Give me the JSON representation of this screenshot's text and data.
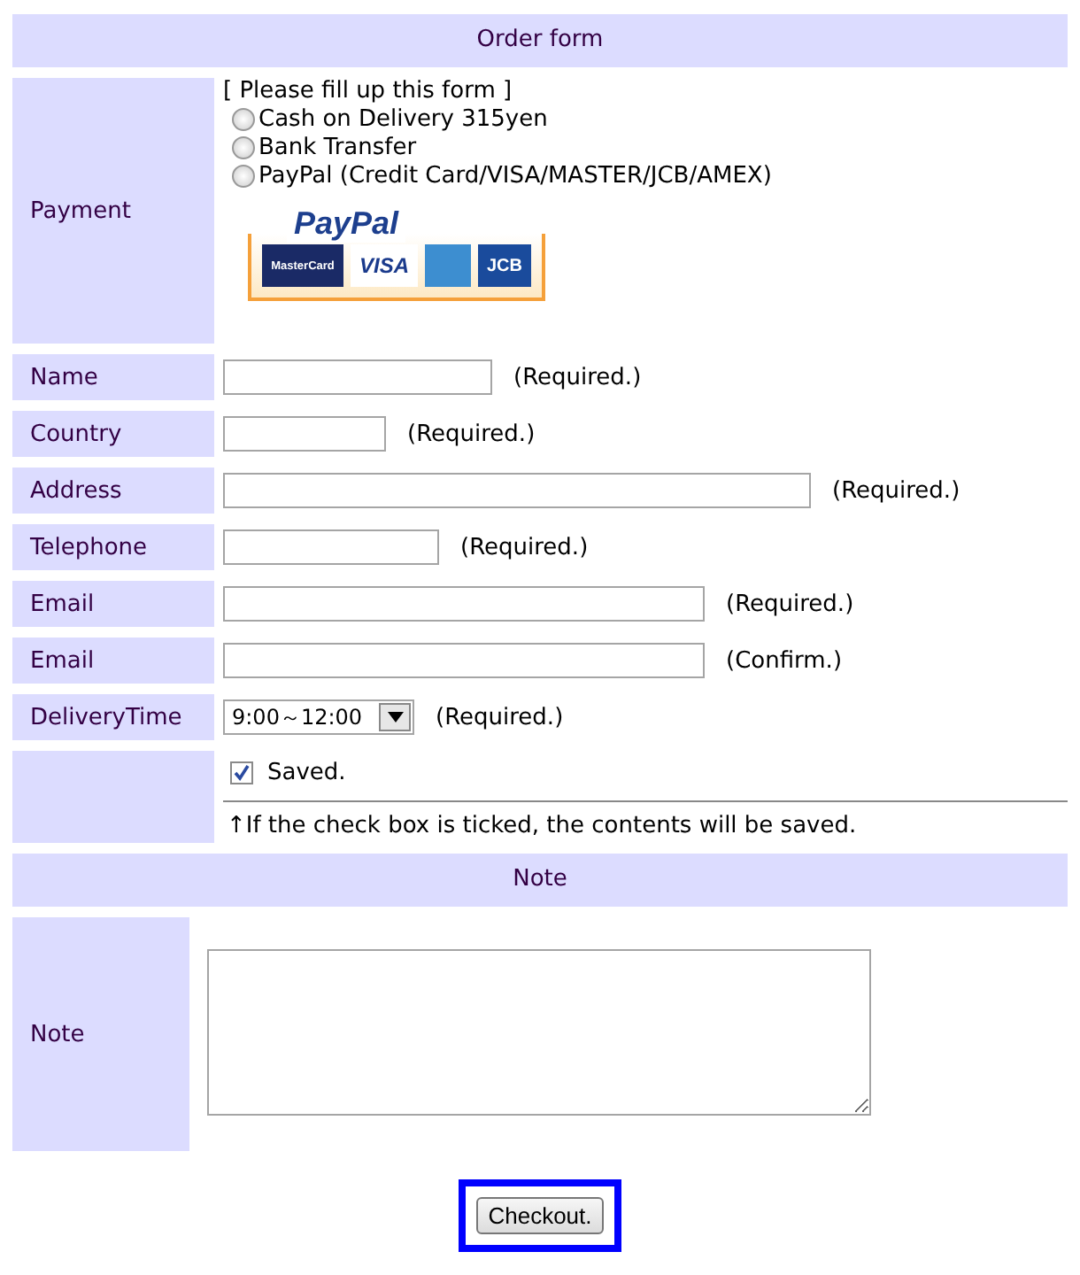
{
  "header": "Order form",
  "payment": {
    "label": "Payment",
    "intro": "[ Please fill up this form ]",
    "options": [
      {
        "label": "Cash on Delivery 315yen",
        "selected": false
      },
      {
        "label": "Bank Transfer",
        "selected": false
      },
      {
        "label": "PayPal (Credit Card/VISA/MASTER/JCB/AMEX)",
        "selected": false
      }
    ],
    "logo": {
      "title": "PayPal",
      "cards": [
        "MasterCard",
        "VISA",
        "JCB"
      ]
    }
  },
  "fields": [
    {
      "kind": "text",
      "label": "Name",
      "hint": "(Required.)"
    },
    {
      "kind": "text",
      "label": "Country",
      "hint": "(Required.)"
    },
    {
      "kind": "text",
      "label": "Address",
      "hint": "(Required.)"
    },
    {
      "kind": "text",
      "label": "Telephone",
      "hint": "(Required.)"
    },
    {
      "kind": "text",
      "label": "Email",
      "hint": "(Required.)"
    },
    {
      "kind": "text",
      "label": "Email",
      "hint": "(Confirm.)"
    },
    {
      "kind": "select",
      "label": "DeliveryTime",
      "value": "9:00～12:00",
      "hint": "(Required.)"
    }
  ],
  "save": {
    "label": "Saved.",
    "checked": true,
    "note": "↑If the check box is ticked, the contents will be saved."
  },
  "note_header": "Note",
  "note": {
    "label": "Note"
  },
  "checkout": "Checkout."
}
